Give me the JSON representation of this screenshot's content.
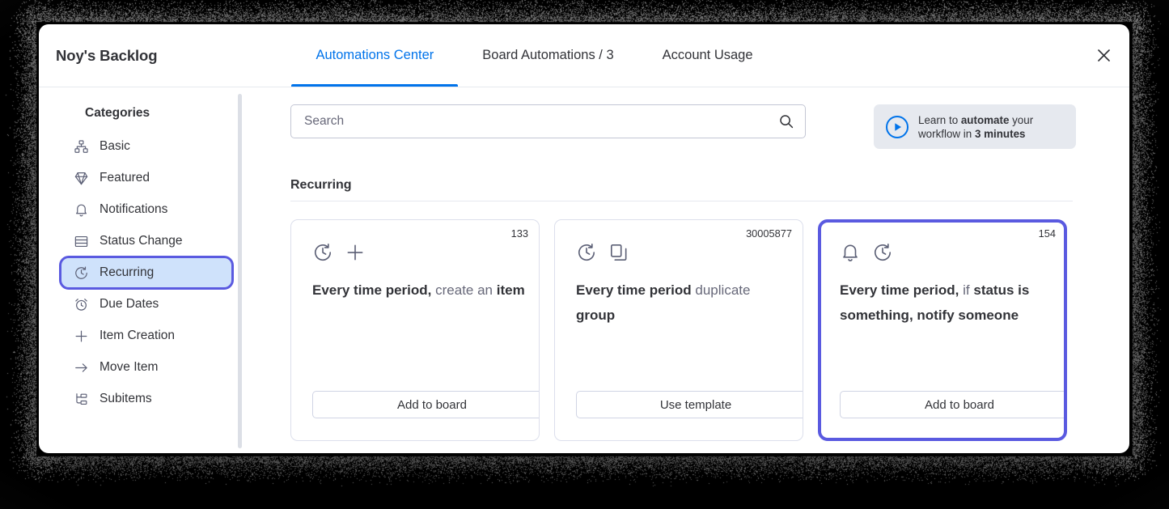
{
  "window": {
    "board_title": "Noy's Backlog",
    "close_icon": "close-icon"
  },
  "tabs": [
    {
      "label": "Automations Center",
      "active": true
    },
    {
      "label": "Board Automations / 3",
      "active": false
    },
    {
      "label": "Account Usage",
      "active": false
    }
  ],
  "sidebar": {
    "heading": "Categories",
    "items": [
      {
        "label": "Basic",
        "icon": "sitemap-icon",
        "selected": false
      },
      {
        "label": "Featured",
        "icon": "diamond-icon",
        "selected": false
      },
      {
        "label": "Notifications",
        "icon": "bell-icon",
        "selected": false
      },
      {
        "label": "Status Change",
        "icon": "rows-icon",
        "selected": false
      },
      {
        "label": "Recurring",
        "icon": "recurring-icon",
        "selected": true
      },
      {
        "label": "Due Dates",
        "icon": "alarm-clock-icon",
        "selected": false
      },
      {
        "label": "Item Creation",
        "icon": "plus-icon",
        "selected": false
      },
      {
        "label": "Move Item",
        "icon": "arrow-right-icon",
        "selected": false
      },
      {
        "label": "Subitems",
        "icon": "subitems-icon",
        "selected": false
      }
    ]
  },
  "search": {
    "value": "",
    "placeholder": "Search",
    "icon": "search-icon"
  },
  "promo": {
    "icon": "play-circle-icon",
    "line1_pre": "Learn to ",
    "line1_bold": "automate",
    "line1_post": " your",
    "line2_pre": "workflow in ",
    "line2_bold": "3 minutes"
  },
  "section": {
    "title": "Recurring"
  },
  "cards": [
    {
      "id": "133",
      "icons": [
        "recurring-icon",
        "plus-icon"
      ],
      "parts": [
        {
          "text": "Every time period",
          "bold": true
        },
        {
          "text": ", ",
          "bold": true
        },
        {
          "text": "create an ",
          "bold": false
        },
        {
          "text": "item",
          "bold": true
        }
      ],
      "button_label": "Add to board",
      "highlighted": false
    },
    {
      "id": "30005877",
      "icons": [
        "recurring-icon",
        "duplicate-icon"
      ],
      "parts": [
        {
          "text": "Every time period",
          "bold": true
        },
        {
          "text": " duplicate ",
          "bold": false
        },
        {
          "text": "group",
          "bold": true
        }
      ],
      "button_label": "Use template",
      "highlighted": false
    },
    {
      "id": "154",
      "icons": [
        "bell-icon",
        "recurring-icon"
      ],
      "parts": [
        {
          "text": "Every time period",
          "bold": true
        },
        {
          "text": ", ",
          "bold": true
        },
        {
          "text": "if ",
          "bold": false
        },
        {
          "text": "status is something",
          "bold": true
        },
        {
          "text": ", ",
          "bold": true
        },
        {
          "text": "notify someone",
          "bold": true
        }
      ],
      "button_label": "Add to board",
      "highlighted": true
    }
  ],
  "colors": {
    "accent_blue": "#0073ea",
    "highlight_outline": "#5a5ae0",
    "highlight_fill": "#cfe2fb",
    "text": "#323338",
    "muted_text": "#676879",
    "backdrop": "#000000"
  }
}
